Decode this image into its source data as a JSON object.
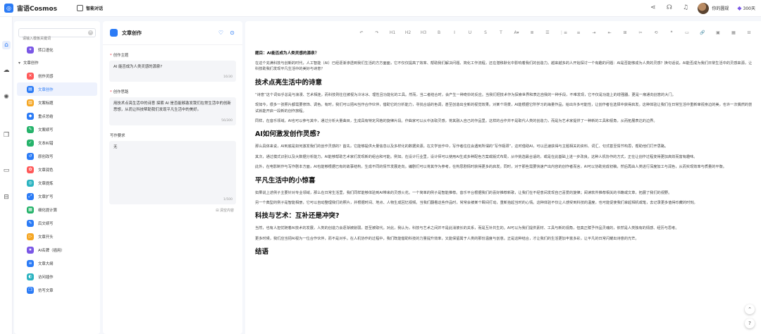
{
  "app": {
    "brand": "宙语Cosmos",
    "nav_title": "智能对话"
  },
  "topbar": {
    "user_name": "你的圆规",
    "vip_label": "300天"
  },
  "sidebar": {
    "search_placeholder": "请输入模板关键词",
    "items": [
      {
        "label": "转口语化",
        "kind": "item",
        "color": "#7a57e6",
        "glyph": "✦"
      },
      {
        "label": "文章创作",
        "kind": "group"
      },
      {
        "label": "创作灵感",
        "kind": "item",
        "color": "#ff5a5a",
        "glyph": "✕"
      },
      {
        "label": "文章创作",
        "kind": "item",
        "color": "#2b7bf6",
        "glyph": "▤",
        "active": true
      },
      {
        "label": "文案标题",
        "kind": "item",
        "color": "#f5a623",
        "glyph": "▥"
      },
      {
        "label": "重点总结",
        "kind": "item",
        "color": "#2b7bf6",
        "glyph": "◆"
      },
      {
        "label": "文案续写",
        "kind": "item",
        "color": "#26b36b",
        "glyph": "✎"
      },
      {
        "label": "文本纠错",
        "kind": "item",
        "color": "#26b36b",
        "glyph": "✓"
      },
      {
        "label": "原创改写",
        "kind": "item",
        "color": "#2b7bf6",
        "glyph": "↺"
      },
      {
        "label": "文章润色",
        "kind": "item",
        "color": "#ff5a5a",
        "glyph": "✿"
      },
      {
        "label": "文章提炼",
        "kind": "item",
        "color": "#2bb3c0",
        "glyph": "◎"
      },
      {
        "label": "文章扩写",
        "kind": "item",
        "color": "#2b7bf6",
        "glyph": "⤢"
      },
      {
        "label": "细化提计算",
        "kind": "item",
        "color": "#26b36b",
        "glyph": "▦"
      },
      {
        "label": "后文续写",
        "kind": "item",
        "color": "#2b7bf6",
        "glyph": "✎"
      },
      {
        "label": "文章开头",
        "kind": "item",
        "color": "#f5a623",
        "glyph": "▷"
      },
      {
        "label": "AI名牌（插用）",
        "kind": "item",
        "color": "#7a57e6",
        "glyph": "★"
      },
      {
        "label": "文章大纲",
        "kind": "item",
        "color": "#2b7bf6",
        "glyph": "≡"
      },
      {
        "label": "访问插作",
        "kind": "item",
        "color": "#2bb3c0",
        "glyph": "◐"
      },
      {
        "label": "仿写文章",
        "kind": "item",
        "color": "#2b7bf6",
        "glyph": "❐"
      }
    ]
  },
  "form": {
    "title": "文章创作",
    "fields": [
      {
        "label": "创作主题",
        "value": "AI 能否成为人类灵感的源泉?",
        "count": "16/30",
        "required": true
      },
      {
        "label": "创作思路",
        "value": "用技术点亮生活中的诗意 探索 AI 是否能够激发我们在常生活中的创新思想，从而让科技帮助我们发现平凡生活中的美好。",
        "count": "56/300",
        "required": true
      },
      {
        "label": "写作要求",
        "value": "无",
        "count": "1/500",
        "required": false
      }
    ],
    "clear_label": "清空内容"
  },
  "editor": {
    "toolbar": [
      "↶",
      "↷",
      "H1",
      "H2",
      "H3",
      "B",
      "I",
      "U",
      "S",
      "T",
      "A▾",
      "≣",
      "☰",
      "⋮≡",
      "≡",
      "⇥",
      "⇤",
      "⊞",
      "✂",
      "⟲",
      "❝",
      "▭",
      "🔗",
      "▣",
      "▦",
      "⊟",
      "⌧",
      "{}",
      "⤢"
    ],
    "question": "题目：AI能否成为人类灵感的源泉？",
    "blocks": [
      {
        "type": "p",
        "text": "在这个充满科技与创新的时代，人工智能（AI）已经逐渐渗透到我们生活的方方面面，它不仅仅提高了效率、帮助我们解决问题、简化工作流程，还在潜移默化中影响着我们的创造力。越来越多的人开始探讨一个有趣的问题：AI是否能够成为人类的灵感？换句话说，AI能否成为我们日常生活中的灵感来源，让科技助我们发现平凡生活中的美好与诗意？"
      },
      {
        "type": "h",
        "text": "技术点亮生活中的诗意"
      },
      {
        "type": "p",
        "text": "“诗意”这个词似乎总是与浪漫、艺术相连，而科技则往往被视为冷冰冰、理性且功能化的工具。然而，当二者结合时，会产生一种奇妙的反应。当我们把技术作为探索世界和表达自我的一种手段，不难发现，它不仅是功能上的增强器，更是一扇通向创意的大门。"
      },
      {
        "type": "p",
        "text": "现如今，很多一张照片都需要修饰、调色。有时，我们可以把AI当作合作伙伴，借助它的分析能力，寻找合适的色调，甚至创造出全新的视觉效果。对某个场景，AI能根据它所学习的海量作品，给出许多可能性，让创作者在选择中获得启发。这种体验让我们在日常生活中重新审视身边的美，也许一次偶然的尝试就能开启一段新的创作旅程。"
      },
      {
        "type": "p",
        "text": "同样，在音乐领域，AI也可以参与其中，通过分析大量曲目，生成具有特定风格的旋律片段。作曲家可以从中汲取灵感，将其融入自己的作品里。这样的合作并不是取代人类的创造力，而是为艺术家提供了一种新的工具和视角，从而拓展表达的边界。"
      },
      {
        "type": "h",
        "text": "AI如何激发创作灵感?"
      },
      {
        "type": "p",
        "text": "那么具体来说，AI到底是如何激发我们的创作灵感的？首先，它能够提供大量信息以及多样化的数据资源。在文学创作中，写作者往往会遇到所谓的“写作瓶颈”，这时借助AI，可以迅速获得与主题相关的资料、词汇、句式甚至情节构思，帮助他们打开思路。"
      },
      {
        "type": "p",
        "text": "其次，通过模式识别以及大数据分析能力，AI能够帮助艺术家们发现新的组合和可能。例如，在设计行业里，设计师可以使用AI生成多种配色方案或版式布局，从中挑选最合适的，或是在此基础上进一步改良。这种人机协作的方式，正在让创作过程变得更加高效而富有趣味。"
      },
      {
        "type": "p",
        "text": "此外，在电影制作与写作剧本方面，AI也能够根据已有的故事结构，生成不同的情节发展走向。编剧们可以将其作为参考，在构思剧情时获得更多的启发。同时，对于那些需要快速产出内容的创作者而言，AI可以协助完成初稿，然后再由人类进行深度加工与润色，从而实现效率与质量的平衡。"
      },
      {
        "type": "h",
        "text": "平凡生活中的小惊喜"
      },
      {
        "type": "p",
        "text": "如果说上述例子主要针对专业领域，那么在日常生活里，我们同样能够体验到AI带来的灵感火花。一个简单的例子是智能推荐。音乐平台根据我们的喜好推荐新歌，让我们在不经意间发现自己喜爱的旋律；阅读软件推荐相关的书籍或文章，拓展了我们的视野。"
      },
      {
        "type": "p",
        "text": "另一个典型的例子是智能相册，它可以自动整理我们的照片，并根据时间、地点、人物生成回忆视频。当我们翻看这些作品时，常常会被某个瞬间打动，重新拾起当时的心情。这种体验不仅让人感受到科技的温度，也可能促使我们拿起相机或笔，去记录更多值得珍藏的时刻。"
      },
      {
        "type": "h",
        "text": "科技与艺术：互补还是冲突?"
      },
      {
        "type": "p",
        "text": "当然，也有人担忧随着AI技术的发展，人类的创造力会逐渐被削弱，甚至被取代。对此，我认为，科技与艺术之间并不是此消彼长的关系，而是互补共生的。AI可以为我们提供素材、工具与新的视角，但真正赋予作品灵魂的，依然是人类独有的情感、经历与思考。"
      },
      {
        "type": "p",
        "text": "更多时候，我们应当把AI视为一位合作伙伴，而不是对手。在人机协作的过程中，我们既能借助科技的力量提升效率，又能保留属于人类的那份温度与创意。正是这种结合，才让我们的生活更加丰富多彩，让平凡的日常闪耀出诗意的光芒。"
      },
      {
        "type": "h",
        "text": "结语"
      }
    ]
  }
}
